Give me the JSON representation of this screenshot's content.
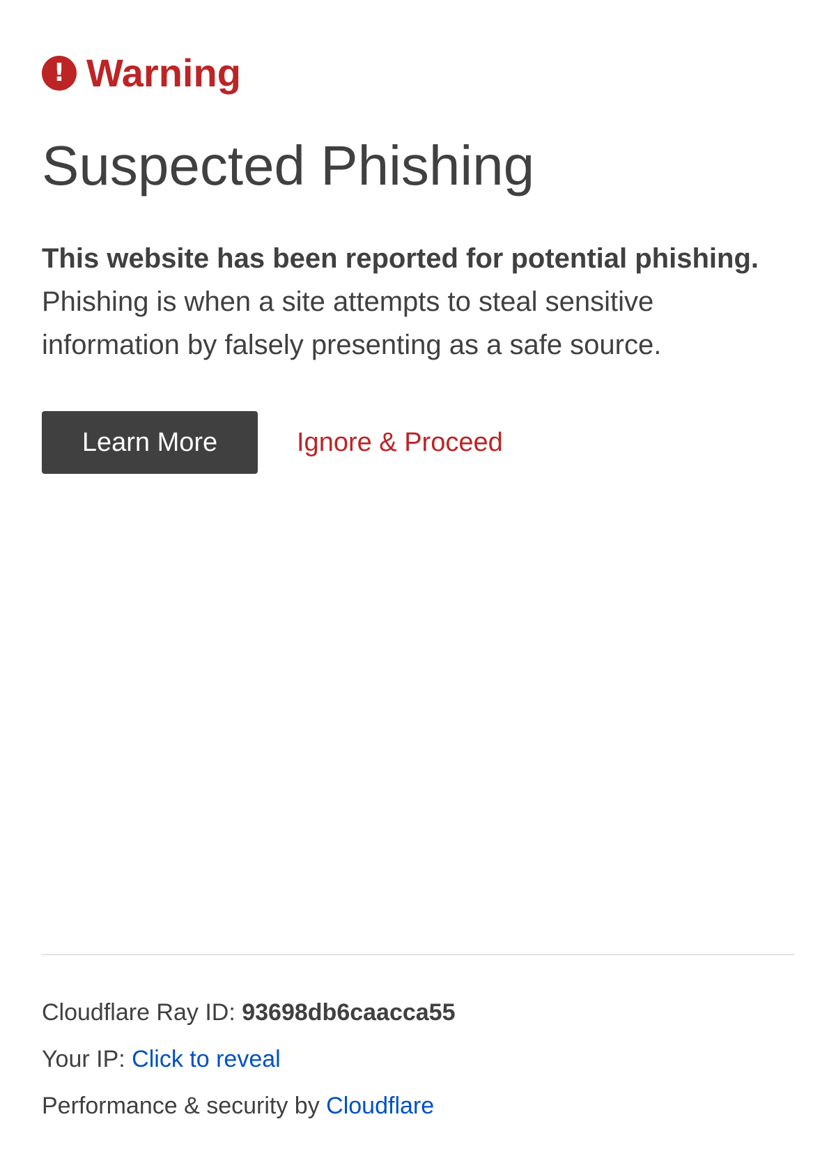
{
  "colors": {
    "warning_red": "#bd2426",
    "text_gray": "#404040",
    "button_bg": "#404040",
    "link_blue": "#0051c3",
    "divider": "#e2e2e2"
  },
  "header": {
    "icon": "exclamation-circle-icon",
    "icon_glyph": "!",
    "warning_label": "Warning"
  },
  "main": {
    "title": "Suspected Phishing",
    "headline": "This website has been reported for potential phishing.",
    "body": "Phishing is when a site attempts to steal sensitive information by falsely presenting as a safe source.",
    "learn_more_label": "Learn More",
    "ignore_label": "Ignore & Proceed"
  },
  "footer": {
    "ray_id_label": "Cloudflare Ray ID: ",
    "ray_id_value": "93698db6caacca55",
    "ip_label": "Your IP: ",
    "ip_link": "Click to reveal",
    "perf_label": "Performance & security by ",
    "perf_link": "Cloudflare"
  }
}
